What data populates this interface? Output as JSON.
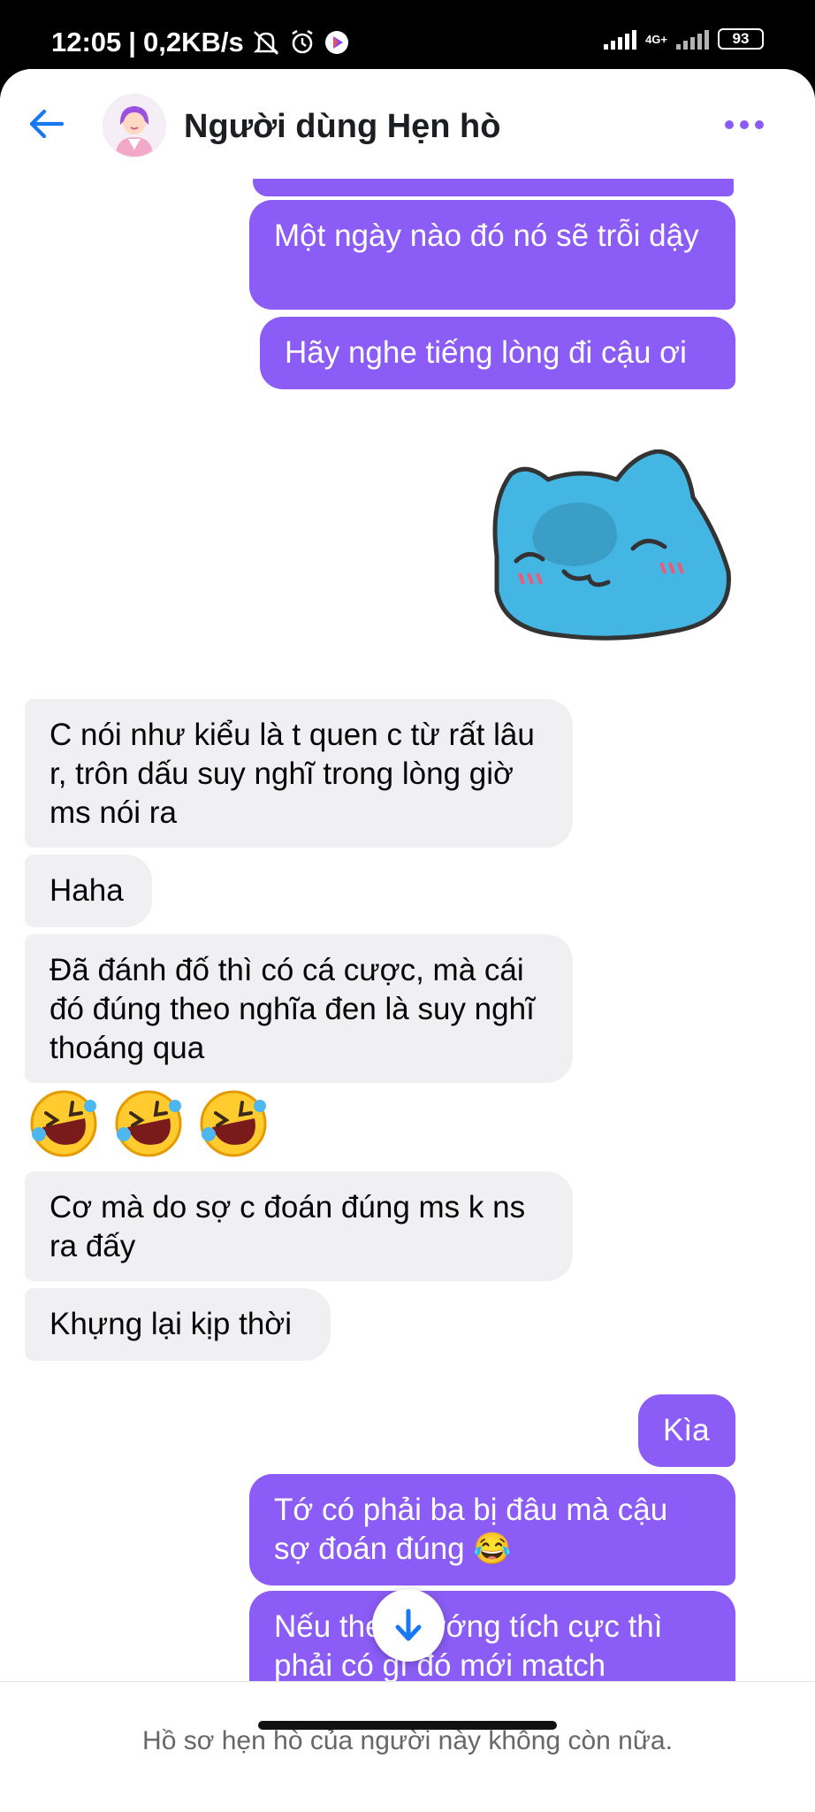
{
  "status_bar": {
    "time": "12:05",
    "separator": "|",
    "network_speed": "0,2KB/s",
    "network_type": "4G+",
    "battery": "93"
  },
  "header": {
    "back_icon": "arrow-left-icon",
    "title": "Người dùng Hẹn hò",
    "more_icon": "more-dots-icon",
    "accent_color": "#8b5cf6"
  },
  "messages": [
    {
      "direction": "outgoing",
      "text": "Một ngày nào đó nó sẽ trỗi dậy"
    },
    {
      "direction": "outgoing",
      "text": "Hãy nghe tiếng lòng đi cậu ơi"
    },
    {
      "direction": "outgoing",
      "type": "sticker",
      "sticker": "blue-cat-sticker"
    },
    {
      "direction": "incoming",
      "text": "C nói như kiểu là t quen c từ rất lâu r, trôn dấu suy nghĩ trong lòng giờ ms nói ra"
    },
    {
      "direction": "incoming",
      "text": "Haha"
    },
    {
      "direction": "incoming",
      "text": "Đã đánh đố thì có cá cược, mà cái đó đúng theo nghĩa đen là suy nghĩ thoáng qua"
    },
    {
      "direction": "incoming",
      "type": "emoji",
      "emoji": "🤣🤣🤣"
    },
    {
      "direction": "incoming",
      "text": "Cơ mà do sợ c đoán đúng ms k ns ra đấy"
    },
    {
      "direction": "incoming",
      "text": "Khựng lại kịp thời"
    },
    {
      "direction": "outgoing",
      "text": "Kìa"
    },
    {
      "direction": "outgoing",
      "text": "Tớ có phải ba bị đâu mà cậu sợ đoán đúng 😂"
    },
    {
      "direction": "outgoing",
      "text": "Nếu theo hướng tích cực thì phải có gì đó mới match"
    }
  ],
  "scroll_button_icon": "arrow-down-icon",
  "footer": {
    "notice": "Hồ sơ hẹn hò của người này không còn nữa."
  },
  "colors": {
    "outgoing_bubble": "#8b5cf6",
    "incoming_bubble": "#f0f0f2",
    "link_blue": "#1877f2"
  }
}
